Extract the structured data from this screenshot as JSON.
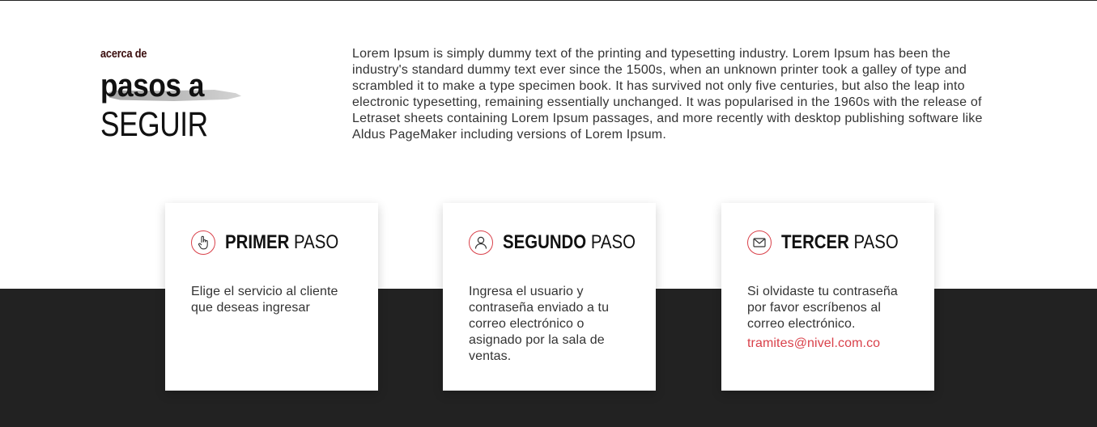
{
  "section": {
    "eyebrow": "acerca de",
    "title_bold": "pasos a",
    "title_light": "SEGUIR",
    "intro": "Lorem Ipsum is simply dummy text of the printing and typesetting industry. Lorem Ipsum has been the industry's standard dummy text ever since the 1500s, when an unknown printer took a galley of type and scrambled it to make a type specimen book. It has survived not only five centuries, but also the leap into electronic typesetting, remaining essentially unchanged. It was popularised in the 1960s with the release of Letraset sheets containing Lorem Ipsum passages, and more recently with desktop publishing software like Aldus PageMaker including versions of Lorem Ipsum."
  },
  "colors": {
    "accent": "#d9414a",
    "dark_band": "#222222",
    "text": "#333333"
  },
  "steps": [
    {
      "icon": "pointer-hand-icon",
      "title_bold": "PRIMER",
      "title_light": "PASO",
      "text": "Elige el servicio al cliente que deseas ingresar"
    },
    {
      "icon": "user-icon",
      "title_bold": "SEGUNDO",
      "title_light": "PASO",
      "text": "Ingresa el usuario y contraseña enviado a tu correo electrónico o asignado por la sala de ventas."
    },
    {
      "icon": "envelope-icon",
      "title_bold": "TERCER",
      "title_light": "PASO",
      "text": "Si olvidaste tu contraseña por favor escríbenos al correo electrónico.",
      "link": "tramites@nivel.com.co"
    }
  ]
}
